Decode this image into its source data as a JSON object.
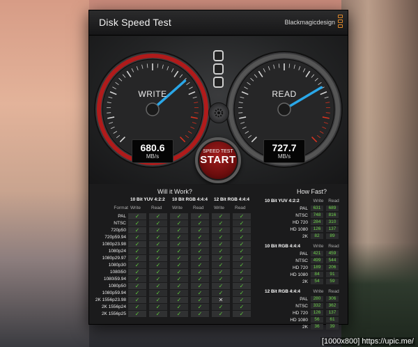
{
  "window": {
    "title": "Disk Speed Test",
    "brand": "Blackmagicdesign"
  },
  "gauges": {
    "write": {
      "label": "WRITE",
      "value": "680.6",
      "unit": "MB/s",
      "level": 0.68
    },
    "read": {
      "label": "READ",
      "value": "727.7",
      "unit": "MB/s",
      "level": 0.72
    }
  },
  "start_button": {
    "small": "SPEED TEST",
    "big": "START"
  },
  "will_it_work": {
    "title": "Will it Work?",
    "format_header": "Format",
    "groups": [
      "10 Bit YUV 4:2:2",
      "10 Bit RGB 4:4:4",
      "12 Bit RGB 4:4:4"
    ],
    "col_write": "Write",
    "col_read": "Read",
    "rows": [
      {
        "format": "PAL",
        "cells": [
          "✓",
          "✓",
          "✓",
          "✓",
          "✓",
          "✓"
        ]
      },
      {
        "format": "NTSC",
        "cells": [
          "✓",
          "✓",
          "✓",
          "✓",
          "✓",
          "✓"
        ]
      },
      {
        "format": "720p50",
        "cells": [
          "✓",
          "✓",
          "✓",
          "✓",
          "✓",
          "✓"
        ]
      },
      {
        "format": "720p59.94",
        "cells": [
          "✓",
          "✓",
          "✓",
          "✓",
          "✓",
          "✓"
        ]
      },
      {
        "format": "1080p23.98",
        "cells": [
          "✓",
          "✓",
          "✓",
          "✓",
          "✓",
          "✓"
        ]
      },
      {
        "format": "1080p24",
        "cells": [
          "✓",
          "✓",
          "✓",
          "✓",
          "✓",
          "✓"
        ]
      },
      {
        "format": "1080p29.97",
        "cells": [
          "✓",
          "✓",
          "✓",
          "✓",
          "✓",
          "✓"
        ]
      },
      {
        "format": "1080p30",
        "cells": [
          "✓",
          "✓",
          "✓",
          "✓",
          "✓",
          "✓"
        ]
      },
      {
        "format": "1080i50",
        "cells": [
          "✓",
          "✓",
          "✓",
          "✓",
          "✓",
          "✓"
        ]
      },
      {
        "format": "1080i59.94",
        "cells": [
          "✓",
          "✓",
          "✓",
          "✓",
          "✓",
          "✓"
        ]
      },
      {
        "format": "1080p50",
        "cells": [
          "✓",
          "✓",
          "✓",
          "✓",
          "✓",
          "✓"
        ]
      },
      {
        "format": "1080p59.94",
        "cells": [
          "✓",
          "✓",
          "✓",
          "✓",
          "✓",
          "✓"
        ]
      },
      {
        "format": "2K 1556p23.98",
        "cells": [
          "✓",
          "✓",
          "✓",
          "✓",
          "✕",
          "✓"
        ]
      },
      {
        "format": "2K 1556p24",
        "cells": [
          "✓",
          "✓",
          "✓",
          "✓",
          "✓",
          "✓"
        ]
      },
      {
        "format": "2K 1556p25",
        "cells": [
          "✓",
          "✓",
          "✓",
          "✓",
          "✓",
          "✓"
        ]
      }
    ]
  },
  "how_fast": {
    "title": "How Fast?",
    "col_write": "Write",
    "col_read": "Read",
    "sections": [
      {
        "name": "10 Bit YUV 4:2:2",
        "rows": [
          {
            "label": "PAL",
            "write": "631",
            "read": "689"
          },
          {
            "label": "NTSC",
            "write": "748",
            "read": "816"
          },
          {
            "label": "HD 720",
            "write": "284",
            "read": "310"
          },
          {
            "label": "HD 1080",
            "write": "126",
            "read": "137"
          },
          {
            "label": "2K",
            "write": "82",
            "read": "89"
          }
        ]
      },
      {
        "name": "10 Bit RGB 4:4:4",
        "rows": [
          {
            "label": "PAL",
            "write": "421",
            "read": "459"
          },
          {
            "label": "NTSC",
            "write": "499",
            "read": "544"
          },
          {
            "label": "HD 720",
            "write": "189",
            "read": "206"
          },
          {
            "label": "HD 1080",
            "write": "84",
            "read": "91"
          },
          {
            "label": "2K",
            "write": "54",
            "read": "59"
          }
        ]
      },
      {
        "name": "12 Bit RGB 4:4:4",
        "rows": [
          {
            "label": "PAL",
            "write": "280",
            "read": "306"
          },
          {
            "label": "NTSC",
            "write": "332",
            "read": "362"
          },
          {
            "label": "HD 720",
            "write": "126",
            "read": "137"
          },
          {
            "label": "HD 1080",
            "write": "56",
            "read": "61"
          },
          {
            "label": "2K",
            "write": "36",
            "read": "39"
          }
        ]
      }
    ]
  },
  "watermark": "[1000x800] https://upic.me/"
}
